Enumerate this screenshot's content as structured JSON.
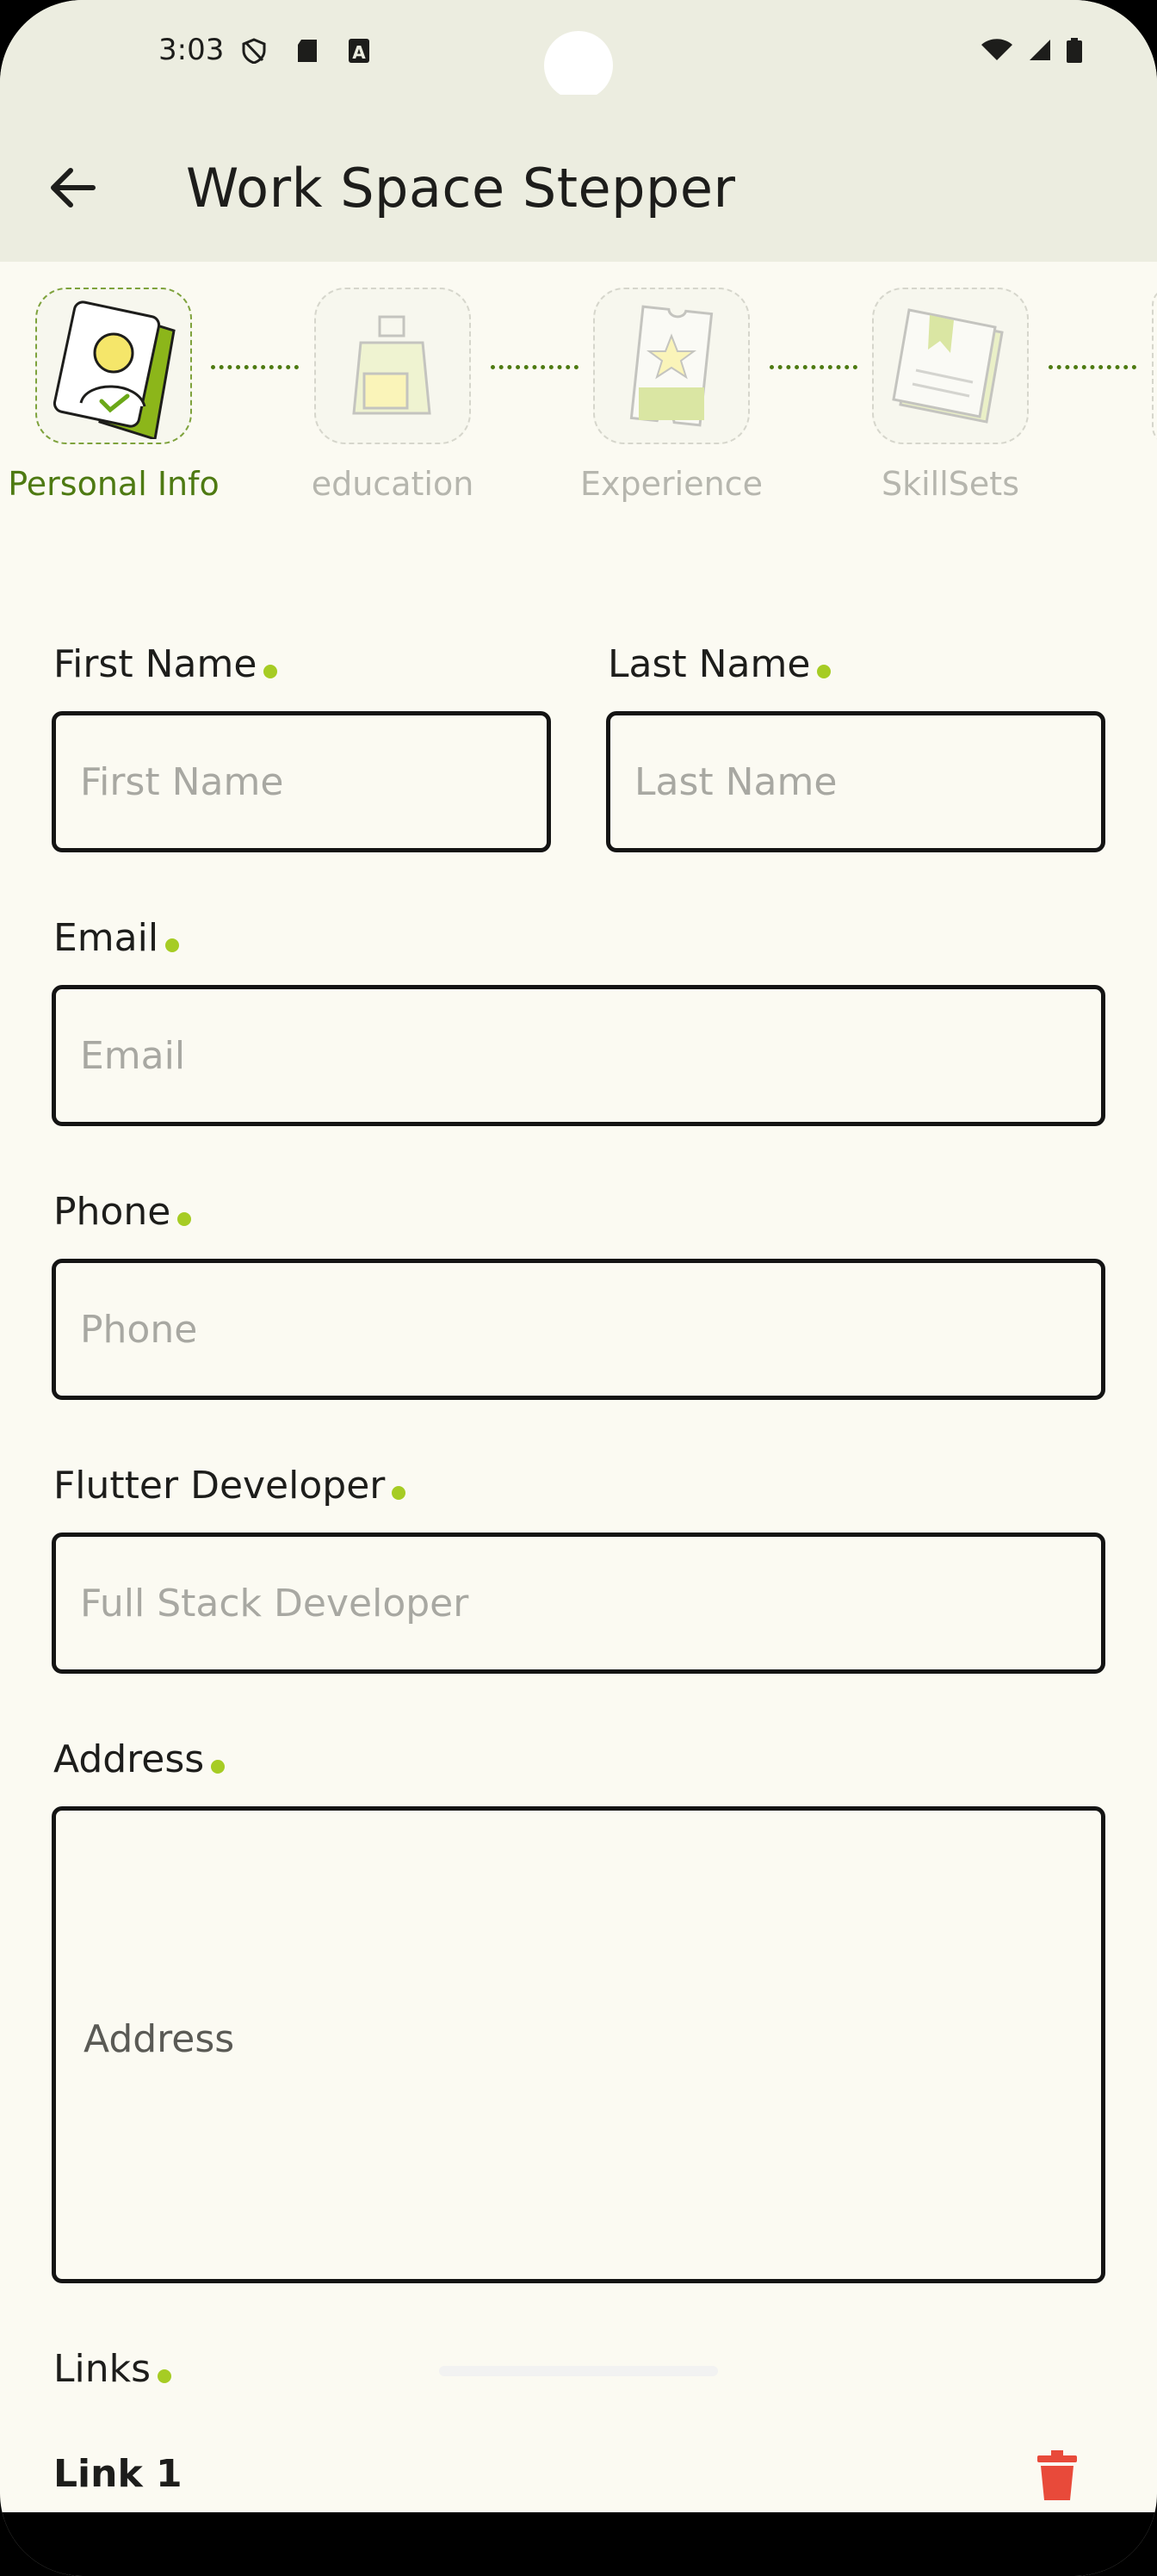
{
  "status_bar": {
    "time": "3:03"
  },
  "app_bar": {
    "title": "Work Space Stepper",
    "back_icon": "arrow-back-icon"
  },
  "stepper": {
    "steps": [
      {
        "label": "Personal Info",
        "icon": "id-card-icon",
        "active": true
      },
      {
        "label": "education",
        "icon": "backpack-icon",
        "active": false
      },
      {
        "label": "Experience",
        "icon": "ticket-star-icon",
        "active": false
      },
      {
        "label": "SkillSets",
        "icon": "book-icon",
        "active": false
      }
    ]
  },
  "form": {
    "first_name": {
      "label": "First Name",
      "placeholder": "First Name",
      "value": ""
    },
    "last_name": {
      "label": "Last Name",
      "placeholder": "Last Name",
      "value": ""
    },
    "email": {
      "label": "Email",
      "placeholder": "Email",
      "value": ""
    },
    "phone": {
      "label": "Phone",
      "placeholder": "Phone",
      "value": ""
    },
    "role": {
      "label": "Flutter Developer",
      "placeholder": "Full Stack Developer",
      "value": ""
    },
    "address": {
      "label": "Address",
      "placeholder": "Address",
      "value": ""
    },
    "links": {
      "label": "Links",
      "items": [
        {
          "title": "Link 1"
        }
      ]
    }
  },
  "colors": {
    "accent": "#4e7a12",
    "required_dot": "#a6cc24",
    "app_bar_bg": "#ecede0",
    "page_bg": "#fbfaf2",
    "delete": "#e84a3a"
  }
}
